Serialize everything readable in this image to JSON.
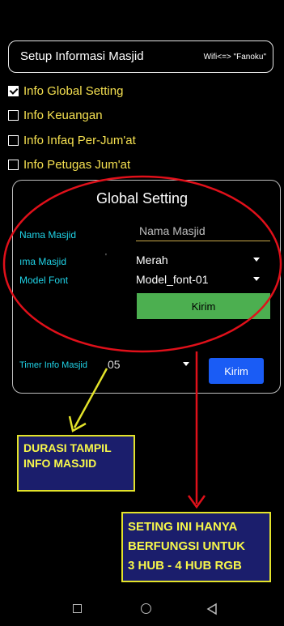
{
  "header": {
    "title": "Setup Informasi Masjid",
    "wifi": "Wifi<=> \"Fanoku\""
  },
  "checkboxes": [
    {
      "label": "Info Global Setting",
      "checked": true
    },
    {
      "label": "Info Keuangan",
      "checked": false
    },
    {
      "label": "Info Infaq Per-Jum'at",
      "checked": false
    },
    {
      "label": "Info Petugas Jum'at",
      "checked": false
    }
  ],
  "card": {
    "title": "Global Setting",
    "nama_masjid": {
      "label": "Nama Masjid",
      "placeholder": "Nama Masjid"
    },
    "warna": {
      "label": "ıma Masjid",
      "value": "Merah"
    },
    "model_font": {
      "label": "Model Font",
      "value": "Model_font-01"
    },
    "kirim1": "Kirim",
    "timer": {
      "label": "Timer Info Masjid",
      "value": "05"
    },
    "kirim2": "Kirim"
  },
  "annotations": {
    "durasi_lines": [
      "DURASI TAMPIL",
      "INFO MASJID"
    ],
    "seting_lines": [
      "SETING INI HANYA",
      "BERFUNGSI UNTUK",
      "3 HUB - 4 HUB RGB"
    ]
  },
  "colors": {
    "accent_yellow": "#f5e050",
    "label_cyan": "#20d4e8",
    "button_green": "#4caf50",
    "button_blue": "#1a5cf5",
    "annotation_red": "#e0101a",
    "note_bg": "#1b1e6c"
  },
  "navbar": {
    "icons": [
      "recent-apps-icon",
      "home-icon",
      "back-icon"
    ]
  }
}
